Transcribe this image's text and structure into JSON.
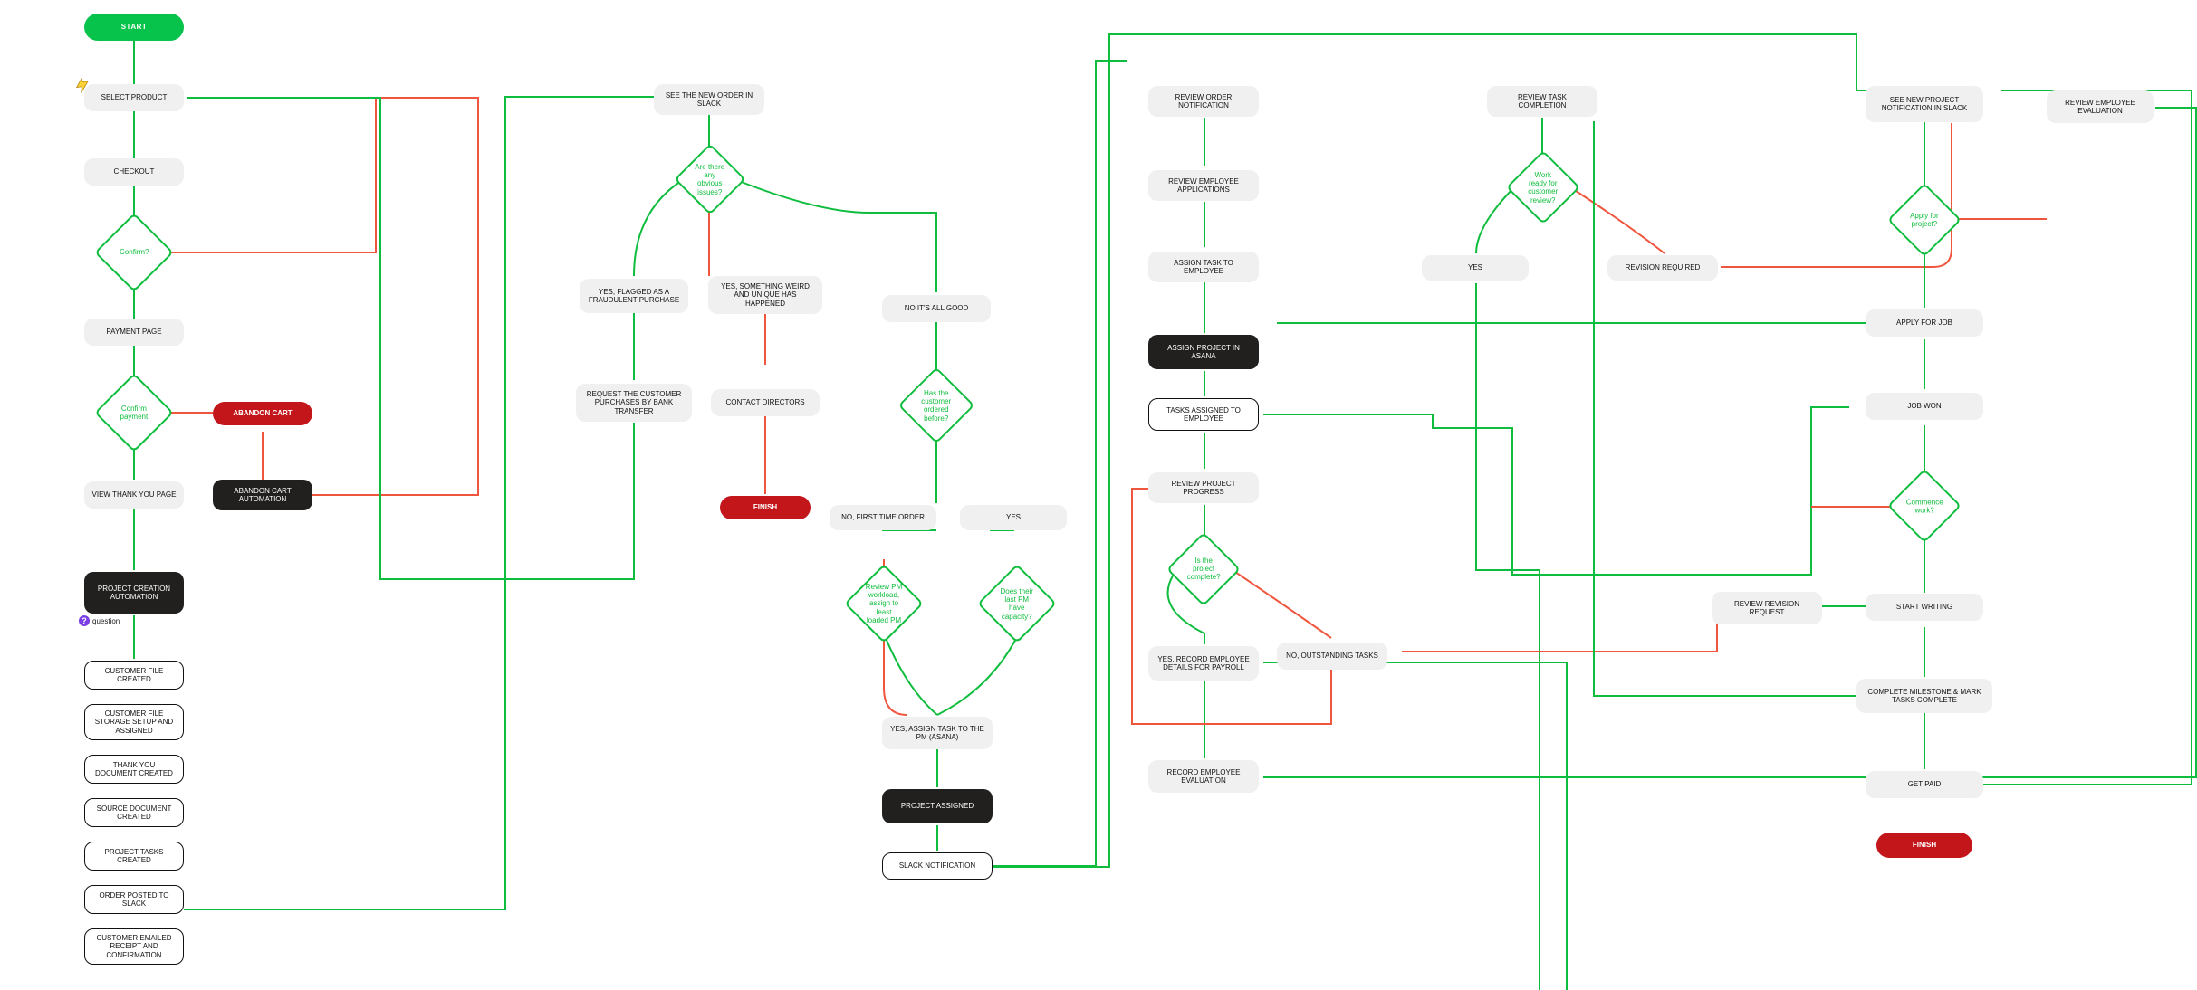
{
  "colors": {
    "green": "#0fbd3e",
    "red_line": "#f0563e",
    "brand_green": "#07c34b",
    "danger": "#c3161a",
    "dark": "#21201e",
    "grey": "#f0f0f0"
  },
  "start": "START",
  "finish": "FINISH",
  "badge_question": "question",
  "col_customer": {
    "select_product": "SELECT PRODUCT",
    "checkout": "CHECKOUT",
    "confirm": "Confirm?",
    "payment_page": "PAYMENT PAGE",
    "confirm_payment": "Confirm payment",
    "abandon_cart": "ABANDON CART",
    "abandon_cart_automation": "ABANDON CART AUTOMATION",
    "view_thankyou": "VIEW THANK YOU PAGE",
    "project_creation_automation": "PROJECT CREATION AUTOMATION",
    "subs": {
      "customer_file_created": "CUSTOMER FILE CREATED",
      "customer_file_storage": "CUSTOMER FILE STORAGE SETUP AND ASSIGNED",
      "thankyou_doc": "THANK YOU DOCUMENT CREATED",
      "source_doc": "SOURCE DOCUMENT CREATED",
      "project_tasks": "PROJECT TASKS CREATED",
      "order_posted_slack": "ORDER POSTED TO SLACK",
      "customer_emailed": "CUSTOMER EMAILED RECEIPT AND CONFIRMATION"
    }
  },
  "col_director": {
    "see_order": "SEE THE NEW ORDER IN SLACK",
    "obvious_issues": "Are there any obvious issues?",
    "flagged_fraud": "YES, FLAGGED AS A FRAUDULENT PURCHASE",
    "something_weird": "YES, SOMETHING WEIRD AND UNIQUE HAS HAPPENED",
    "all_good": "NO IT'S ALL GOOD",
    "request_bank": "REQUEST THE CUSTOMER PURCHASES BY BANK TRANSFER",
    "contact_directors": "CONTACT DIRECTORS",
    "ordered_before": "Has the customer ordered before?",
    "first_time": "NO, FIRST TIME ORDER",
    "yes": "YES",
    "review_pm_workload": "Review PM workload, assign to least loaded PM",
    "last_pm_capacity": "Does their last PM have capacity?",
    "assign_pm": "YES, ASSIGN TASK TO THE PM (ASANA)",
    "project_assigned": "PROJECT ASSIGNED",
    "slack_notification": "SLACK NOTIFICATION"
  },
  "col_pm": {
    "review_order": "REVIEW ORDER NOTIFICATION",
    "review_applications": "REVIEW EMPLOYEE APPLICATIONS",
    "assign_task_emp": "ASSIGN TASK TO EMPLOYEE",
    "assign_project_asana": "ASSIGN PROJECT IN ASANA",
    "tasks_assigned_emp": "TASKS ASSIGNED TO EMPLOYEE",
    "review_progress": "REVIEW PROJECT PROGRESS",
    "is_project_complete": "Is the project complete?",
    "record_payroll": "YES, RECORD EMPLOYEE DETAILS FOR PAYROLL",
    "outstanding": "NO, OUTSTANDING TASKS",
    "record_evaluation": "RECORD EMPLOYEE EVALUATION",
    "review_task_completion": "REVIEW TASK COMPLETION",
    "work_ready": "Work ready for customer review?",
    "opt_yes": "YES",
    "revision_required": "REVISION REQUIRED",
    "review_revision_request": "REVIEW REVISION REQUEST"
  },
  "col_employee": {
    "see_project_slack": "SEE NEW PROJECT NOTIFICATION IN SLACK",
    "review_evaluation": "REVIEW EMPLOYEE EVALUATION",
    "apply_for_project": "Apply for project?",
    "apply_for_job": "APPLY FOR JOB",
    "job_won": "JOB WON",
    "commence": "Commence work?",
    "start_writing": "START WRITING",
    "complete_milestone": "COMPLETE MILESTONE & MARK TASKS COMPLETE",
    "get_paid": "GET PAID"
  }
}
